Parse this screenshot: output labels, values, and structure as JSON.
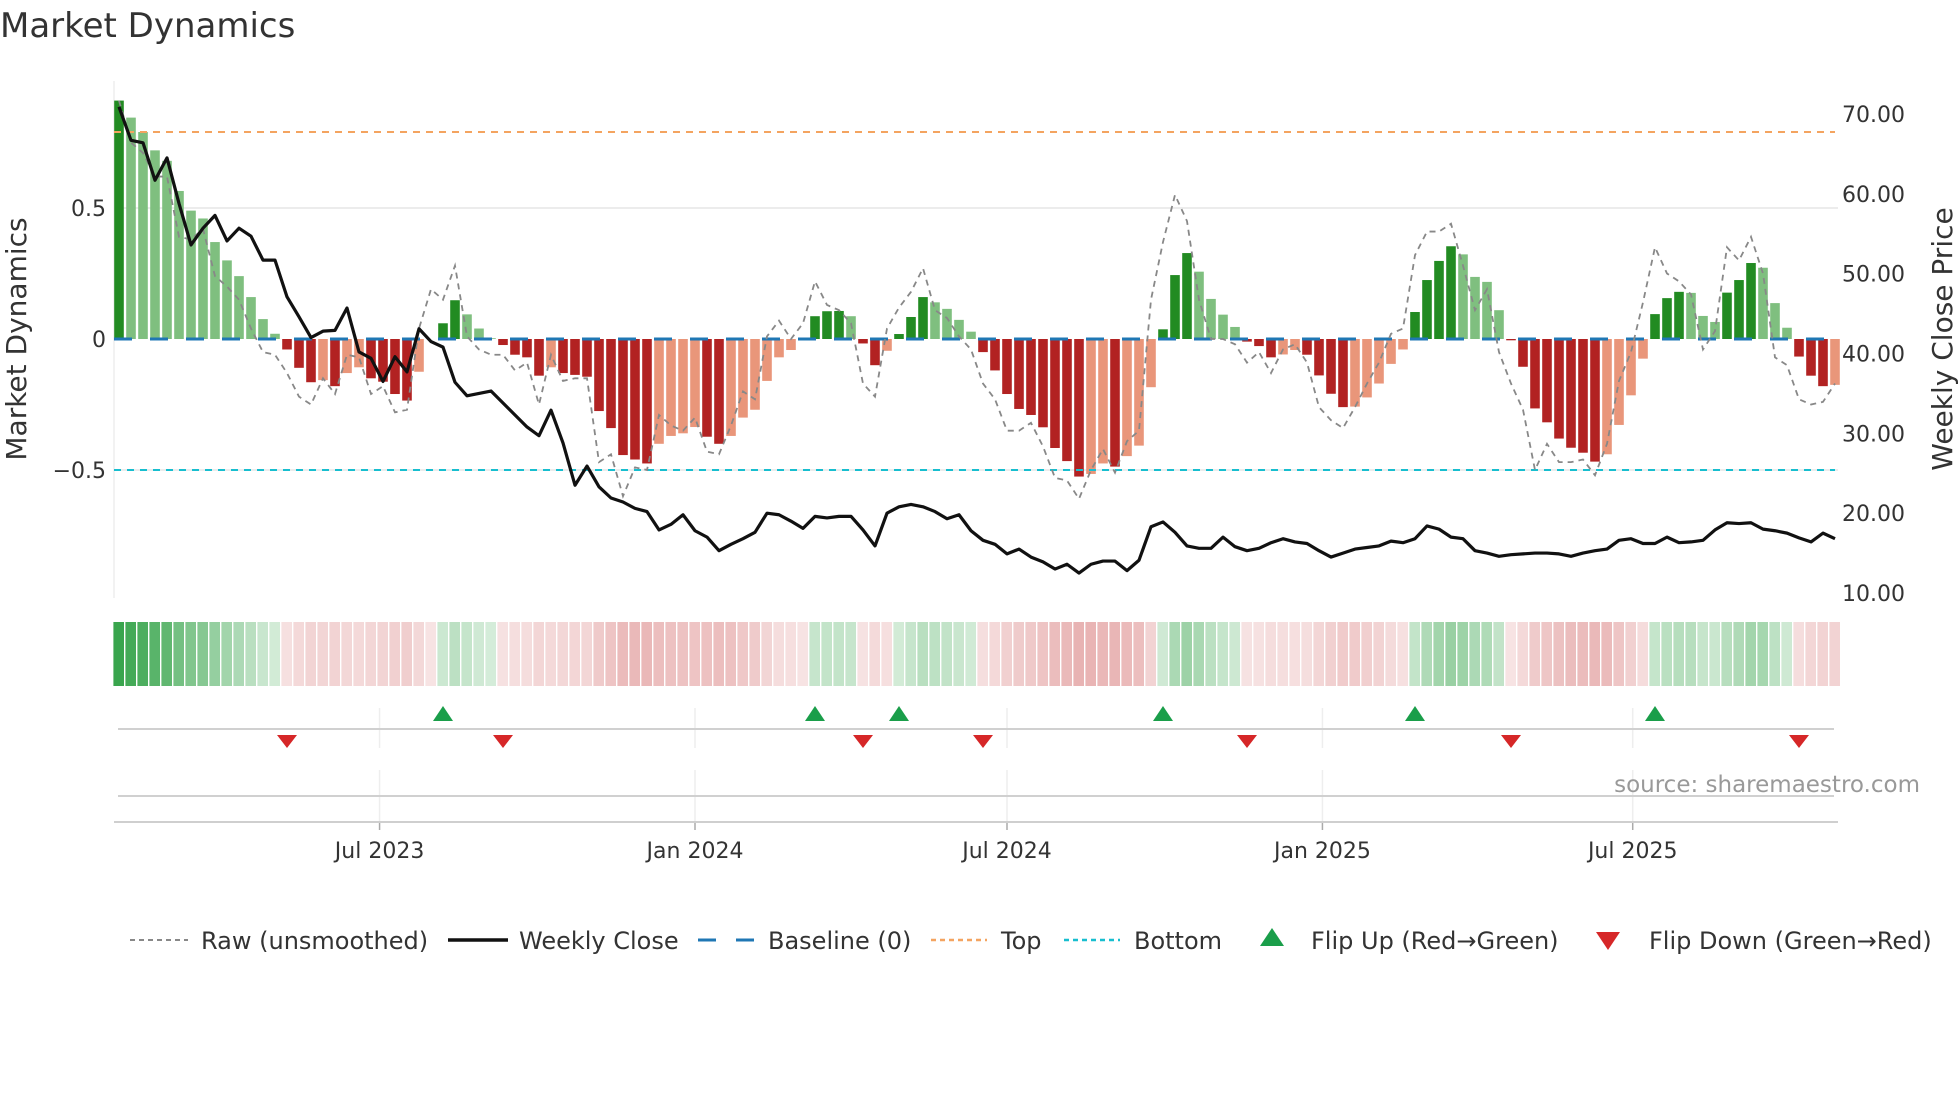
{
  "title": "Market Dynamics",
  "source": "source: sharemaestro.com",
  "colors": {
    "up_strong": "#228b22",
    "up_weak": "#7fbf7f",
    "down_strong": "#b22222",
    "down_weak": "#e9967a",
    "close": "#111111",
    "raw": "#888888",
    "baseline": "#1f77b4",
    "top": "#f4a460",
    "bottom": "#17becf",
    "flip_up": "#1a9e4a",
    "flip_down": "#d62728"
  },
  "chart_data": {
    "type": "bar",
    "title": "Market Dynamics",
    "ylabel": "Market Dynamics",
    "y2label": "Weekly Close Price",
    "start_date": "2023-01-30",
    "frequency": "weekly",
    "ylim": [
      -0.98,
      1.0
    ],
    "y2lim": [
      10,
      75
    ],
    "yticks": [
      {
        "v": 0.5,
        "label": "0.5"
      },
      {
        "v": 0,
        "label": "0"
      },
      {
        "v": -0.5,
        "label": "−0.5"
      }
    ],
    "y2ticks": [
      {
        "v": 70,
        "label": "70.00"
      },
      {
        "v": 60,
        "label": "60.00"
      },
      {
        "v": 50,
        "label": "50.00"
      },
      {
        "v": 40,
        "label": "40.00"
      },
      {
        "v": 30,
        "label": "30.00"
      },
      {
        "v": 20,
        "label": "20.00"
      },
      {
        "v": 10,
        "label": "10.00"
      }
    ],
    "xticks": [
      {
        "date": "2023-07-01",
        "label": "Jul 2023"
      },
      {
        "date": "2024-01-01",
        "label": "Jan 2024"
      },
      {
        "date": "2024-07-01",
        "label": "Jul 2024"
      },
      {
        "date": "2025-01-01",
        "label": "Jan 2025"
      },
      {
        "date": "2025-07-01",
        "label": "Jul 2025"
      }
    ],
    "top_level": 0.79,
    "bottom_level": -0.5,
    "baseline": 0,
    "dynamics": [
      0.91,
      0.845,
      0.79,
      0.72,
      0.68,
      0.565,
      0.49,
      0.46,
      0.37,
      0.3,
      0.24,
      0.16,
      0.076,
      0.02,
      -0.04,
      -0.11,
      -0.165,
      -0.157,
      -0.18,
      -0.13,
      -0.108,
      -0.15,
      -0.163,
      -0.21,
      -0.235,
      -0.125,
      0,
      0.06,
      0.148,
      0.094,
      0.04,
      0.003,
      -0.023,
      -0.06,
      -0.07,
      -0.14,
      -0.108,
      -0.13,
      -0.137,
      -0.144,
      -0.275,
      -0.34,
      -0.443,
      -0.46,
      -0.475,
      -0.4,
      -0.37,
      -0.36,
      -0.336,
      -0.373,
      -0.4,
      -0.37,
      -0.3,
      -0.27,
      -0.16,
      -0.07,
      -0.042,
      0,
      0.087,
      0.106,
      0.107,
      0.087,
      -0.017,
      -0.1,
      -0.045,
      0.019,
      0.084,
      0.16,
      0.14,
      0.115,
      0.073,
      0.028,
      -0.05,
      -0.12,
      -0.21,
      -0.267,
      -0.29,
      -0.337,
      -0.416,
      -0.466,
      -0.525,
      -0.515,
      -0.475,
      -0.487,
      -0.447,
      -0.407,
      -0.184,
      0.037,
      0.244,
      0.328,
      0.257,
      0.153,
      0.093,
      0.046,
      -0.01,
      -0.027,
      -0.07,
      -0.059,
      -0.042,
      -0.06,
      -0.139,
      -0.209,
      -0.26,
      -0.258,
      -0.223,
      -0.17,
      -0.095,
      -0.04,
      0.103,
      0.225,
      0.298,
      0.354,
      0.323,
      0.237,
      0.218,
      0.11,
      -0.005,
      -0.106,
      -0.265,
      -0.318,
      -0.38,
      -0.415,
      -0.434,
      -0.468,
      -0.44,
      -0.328,
      -0.215,
      -0.075,
      0.095,
      0.156,
      0.18,
      0.176,
      0.088,
      0.065,
      0.177,
      0.225,
      0.29,
      0.272,
      0.137,
      0.043,
      -0.067,
      -0.14,
      -0.18,
      -0.175
    ],
    "raw": [
      0.91,
      0.75,
      0.71,
      0.62,
      0.62,
      0.39,
      0.38,
      0.42,
      0.24,
      0.2,
      0.15,
      0.04,
      -0.05,
      -0.06,
      -0.13,
      -0.22,
      -0.25,
      -0.15,
      -0.21,
      -0.06,
      -0.07,
      -0.21,
      -0.18,
      -0.28,
      -0.27,
      0.04,
      0.19,
      0.15,
      0.28,
      0.01,
      -0.04,
      -0.06,
      -0.06,
      -0.12,
      -0.09,
      -0.25,
      -0.06,
      -0.16,
      -0.15,
      -0.15,
      -0.47,
      -0.44,
      -0.6,
      -0.49,
      -0.5,
      -0.29,
      -0.33,
      -0.35,
      -0.3,
      -0.43,
      -0.44,
      -0.33,
      -0.2,
      -0.23,
      0.01,
      0.07,
      0.0,
      0.06,
      0.22,
      0.13,
      0.11,
      0.06,
      -0.17,
      -0.22,
      0.04,
      0.12,
      0.18,
      0.27,
      0.11,
      0.08,
      0.01,
      -0.04,
      -0.17,
      -0.23,
      -0.35,
      -0.35,
      -0.32,
      -0.41,
      -0.53,
      -0.54,
      -0.61,
      -0.5,
      -0.42,
      -0.51,
      -0.39,
      -0.35,
      0.15,
      0.37,
      0.55,
      0.45,
      0.15,
      0.0,
      0.0,
      -0.02,
      -0.09,
      -0.05,
      -0.13,
      -0.04,
      -0.02,
      -0.09,
      -0.26,
      -0.31,
      -0.34,
      -0.26,
      -0.17,
      -0.09,
      0.02,
      0.04,
      0.32,
      0.41,
      0.41,
      0.44,
      0.28,
      0.11,
      0.19,
      -0.05,
      -0.17,
      -0.27,
      -0.5,
      -0.4,
      -0.47,
      -0.47,
      -0.46,
      -0.52,
      -0.4,
      -0.16,
      -0.05,
      0.14,
      0.35,
      0.25,
      0.22,
      0.17,
      -0.04,
      0.03,
      0.35,
      0.3,
      0.39,
      0.25,
      -0.07,
      -0.1,
      -0.23,
      -0.25,
      -0.24,
      -0.17
    ],
    "close": [
      70.9,
      66.7,
      66.4,
      61.7,
      64.5,
      58.8,
      53.6,
      55.7,
      57.3,
      54.1,
      55.7,
      54.7,
      51.7,
      51.7,
      47.1,
      44.6,
      42.0,
      42.8,
      42.9,
      45.7,
      40.2,
      39.4,
      36.5,
      39.6,
      37.7,
      43.1,
      41.5,
      40.8,
      36.4,
      34.7,
      35.0,
      35.3,
      33.8,
      32.3,
      30.8,
      29.7,
      32.9,
      28.8,
      23.5,
      25.9,
      23.3,
      21.9,
      21.4,
      20.6,
      20.2,
      17.9,
      18.6,
      19.8,
      17.8,
      17.0,
      15.3,
      16.1,
      16.8,
      17.6,
      20.0,
      19.8,
      19.0,
      18.1,
      19.6,
      19.4,
      19.6,
      19.6,
      17.9,
      15.9,
      20.0,
      20.8,
      21.1,
      20.8,
      20.2,
      19.3,
      19.8,
      17.8,
      16.6,
      16.1,
      14.9,
      15.5,
      14.5,
      13.9,
      13.0,
      13.6,
      12.5,
      13.6,
      14.0,
      14.0,
      12.8,
      14.1,
      18.3,
      18.9,
      17.6,
      15.9,
      15.6,
      15.6,
      17.0,
      15.8,
      15.3,
      15.6,
      16.3,
      16.8,
      16.4,
      16.2,
      15.3,
      14.5,
      15.0,
      15.5,
      15.7,
      15.9,
      16.5,
      16.3,
      16.8,
      18.4,
      18.0,
      17.0,
      16.8,
      15.3,
      15.0,
      14.6,
      14.8,
      14.9,
      15.0,
      15.0,
      14.9,
      14.6,
      15.0,
      15.3,
      15.5,
      16.6,
      16.8,
      16.2,
      16.2,
      17.0,
      16.3,
      16.4,
      16.6,
      17.9,
      18.8,
      18.7,
      18.8,
      18.0,
      17.8,
      17.5,
      16.9,
      16.4,
      17.5,
      16.8
    ],
    "flip_up_weeks": [
      27,
      58,
      65,
      87,
      108,
      128
    ],
    "flip_down_weeks": [
      14,
      32,
      62,
      72,
      94,
      116,
      140
    ],
    "legend": {
      "placement": "bottom",
      "items": [
        {
          "key": "raw",
          "label": "Raw (unsmoothed)"
        },
        {
          "key": "close",
          "label": "Weekly Close"
        },
        {
          "key": "baseline",
          "label": "Baseline (0)"
        },
        {
          "key": "top",
          "label": "Top"
        },
        {
          "key": "bottom",
          "label": "Bottom"
        },
        {
          "key": "flip_up",
          "label": "Flip Up (Red→Green)"
        },
        {
          "key": "flip_down",
          "label": "Flip Down (Green→Red)"
        }
      ]
    }
  }
}
